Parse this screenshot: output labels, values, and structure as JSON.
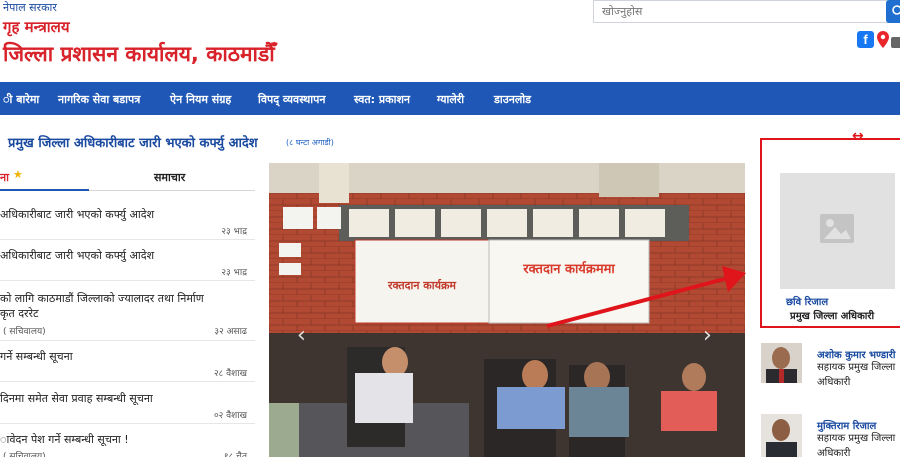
{
  "header": {
    "government": "नेपाल सरकार",
    "ministry": "गृह मन्त्रालय",
    "office": "जिल्ला प्रशासन कार्यालय, काठमाडौँ",
    "search_placeholder": "खोज्नुहोस"
  },
  "nav": {
    "items": [
      "ी बारेमा",
      "नागरिक सेवा बडापत्र",
      "ऐन नियम संग्रह",
      "विपद् व्यवस्थापन",
      "स्वत: प्रकाशन",
      "ग्यालेरी",
      "डाउनलोड"
    ]
  },
  "headline": {
    "text": "प्रमुख जिल्ला अधिकारीबाट जारी भएको कर्फ्यु आदेश",
    "time": "(८ घन्टा अगाडी)"
  },
  "tabs": {
    "first": "ना",
    "second": "समाचार"
  },
  "news": [
    {
      "title": "अधिकारीबाट जारी भएको कर्फ्यु आदेश",
      "source": "",
      "date": "२३ भाद्र"
    },
    {
      "title": "अधिकारीबाट जारी भएको कर्फ्यु आदेश",
      "source": "",
      "date": "२३ भाद्र"
    },
    {
      "title": "को लागि काठमाडौं जिल्लाको ज्यालादर तथा निर्माण",
      "title2": "कृत दररेट",
      "source": "( सचिवालय)",
      "date": "३२ असाढ"
    },
    {
      "title": "गर्ने सम्बन्धी सूचना",
      "source": "",
      "date": "२८ वैशाख"
    },
    {
      "title": "दिनमा समेत सेवा प्रवाह सम्बन्धी सूचना",
      "source": "",
      "date": "०२ वैशाख"
    },
    {
      "title": "ावेदन पेश गर्ने सम्बन्धी सूचना !",
      "source": "( सचिवालय)",
      "date": "१८ चैत"
    }
  ],
  "photo": {
    "banner_left": "रक्तदान कार्यक्रम",
    "banner_right": "रक्तदान कार्यक्रममा"
  },
  "officials": {
    "chief": {
      "name": "छवि रिजाल",
      "title": "प्रमुख जिल्ला अधिकारी"
    },
    "assistants": [
      {
        "name": "अशोक कुमार भण्डारी",
        "title1": "सहायक प्रमुख जिल्ला",
        "title2": "अधिकारी"
      },
      {
        "name": "मुक्तिराम रिजाल",
        "title1": "सहायक प्रमुख जिल्ला",
        "title2": "अधिकारी"
      }
    ]
  },
  "colors": {
    "brand_red": "#d8232a",
    "nav_blue": "#1e57b6",
    "link_blue": "#1a4aa0",
    "annotation_red": "#e0141b"
  }
}
